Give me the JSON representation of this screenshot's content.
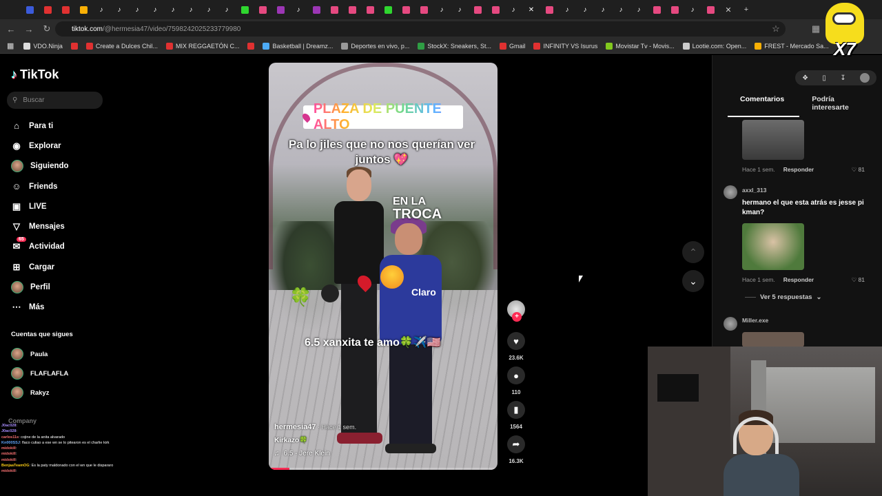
{
  "browser": {
    "url_host": "tiktok.com",
    "url_path": "/@hermesia47/video/7598242025233779980",
    "tab_icons": [
      "#3b5bdb",
      "#e03131",
      "#e03131",
      "#fab005",
      "tiktok",
      "tiktok",
      "tiktok",
      "tiktok",
      "tiktok",
      "tiktok",
      "tiktok",
      "tiktok",
      "#2fd62f",
      "#e64980",
      "#9c36b5",
      "tiktok",
      "#9c36b5",
      "#e64980",
      "#e64980",
      "#e64980",
      "#2fd62f",
      "#e64980",
      "#e64980",
      "tiktok",
      "tiktok",
      "#e64980",
      "#e64980",
      "tiktok",
      "x",
      "#e64980",
      "tiktok",
      "tiktok",
      "tiktok",
      "tiktok",
      "tiktok",
      "#e64980",
      "#e64980",
      "tiktok",
      "#e64980"
    ],
    "bookmarks": [
      {
        "label": "VDO.Ninja",
        "color": "#ddd"
      },
      {
        "label": "",
        "color": "#e03131"
      },
      {
        "label": "Create a Dulces Chil...",
        "color": "#e03131"
      },
      {
        "label": "MIX REGGAETÓN C...",
        "color": "#e03131"
      },
      {
        "label": "",
        "color": "#e03131"
      },
      {
        "label": "Basketball | Dreamz...",
        "color": "#4dabf7"
      },
      {
        "label": "Deportes en vivo, p...",
        "color": "#999"
      },
      {
        "label": "StockX: Sneakers, St...",
        "color": "#2f9e44"
      },
      {
        "label": "Gmail",
        "color": "#e03131"
      },
      {
        "label": "INFINITY VS Isurus",
        "color": "#e03131"
      },
      {
        "label": "Movistar Tv - Movis...",
        "color": "#82c91e"
      },
      {
        "label": "Lootie.com: Open...",
        "color": "#ccc"
      },
      {
        "label": "FREST - Mercado Sa...",
        "color": "#fab005"
      }
    ]
  },
  "sidebar": {
    "logo": "TikTok",
    "search_placeholder": "Buscar",
    "items": [
      {
        "label": "Para ti",
        "icon": "home-icon"
      },
      {
        "label": "Explorar",
        "icon": "compass-icon"
      },
      {
        "label": "Siguiendo",
        "icon": "avatar"
      },
      {
        "label": "Friends",
        "icon": "friends-icon"
      },
      {
        "label": "LIVE",
        "icon": "live-icon"
      },
      {
        "label": "Mensajes",
        "icon": "send-icon"
      },
      {
        "label": "Actividad",
        "icon": "inbox-icon",
        "badge": "65"
      },
      {
        "label": "Cargar",
        "icon": "plus-icon"
      },
      {
        "label": "Perfil",
        "icon": "avatar"
      },
      {
        "label": "Más",
        "icon": "more-icon"
      }
    ],
    "following_title": "Cuentas que sigues",
    "following": [
      "Paula",
      "FLAFLAFLA",
      "Rakyz"
    ],
    "company": "Company"
  },
  "chat": [
    {
      "user": "J0ac028",
      "text": ": ",
      "cls": "u"
    },
    {
      "user": "J0ac028",
      "text": ": ",
      "cls": "u"
    },
    {
      "user": "carlos11s",
      "text": ": cojine de la anita alvarado",
      "cls": "u3"
    },
    {
      "user": "Kn000SSJ",
      "text": ": flaco culiao a ese wn se lo pitearon es el charlie kirk",
      "cls": "u2"
    },
    {
      "user": "midokill",
      "text": ": ",
      "cls": "u3"
    },
    {
      "user": "midokill",
      "text": ": ",
      "cls": "u3"
    },
    {
      "user": "midokill",
      "text": ": ",
      "cls": "u3"
    },
    {
      "user": "BenjaaTeamOG",
      "text": ": Es la paty maldonado con el wn que le dispararo",
      "cls": "u4"
    },
    {
      "user": "midokill",
      "text": ": ",
      "cls": "u3"
    }
  ],
  "video": {
    "place": "PLAZA DE PUENTE ALTO",
    "caption1": "Pa lo jiles que no nos querían ver juntos 💖",
    "troca_a": "EN LA",
    "troca_b": "TROCA",
    "caption2": "6.5 xanxita te amo🍀✈️🇺🇸",
    "shirt_brand": "Claro",
    "author": "hermesia47",
    "time": " · Hace 1 sem.",
    "description": "Kirkazo🍀",
    "music": "6.5 - Jere Klein",
    "progress": 0.09
  },
  "actions": {
    "likes": "23.6K",
    "comments": "110",
    "saves": "1564",
    "shares": "16.3K"
  },
  "comments_panel": {
    "tabs": [
      "Comentarios",
      "Podría interesarte"
    ],
    "c1": {
      "time": "Hace 1 sem.",
      "reply": "Responder",
      "likes": "♡ 81"
    },
    "c2": {
      "user": "axxl_313",
      "text": "hermano el que esta atrás es jesse pi kman?",
      "time": "Hace 1 sem.",
      "reply": "Responder",
      "likes": "♡ 81"
    },
    "see_more": "Ver 5 respuestas",
    "c3": {
      "user": "Miller.exe"
    }
  },
  "overlay": {
    "sticker_text": "X7"
  }
}
